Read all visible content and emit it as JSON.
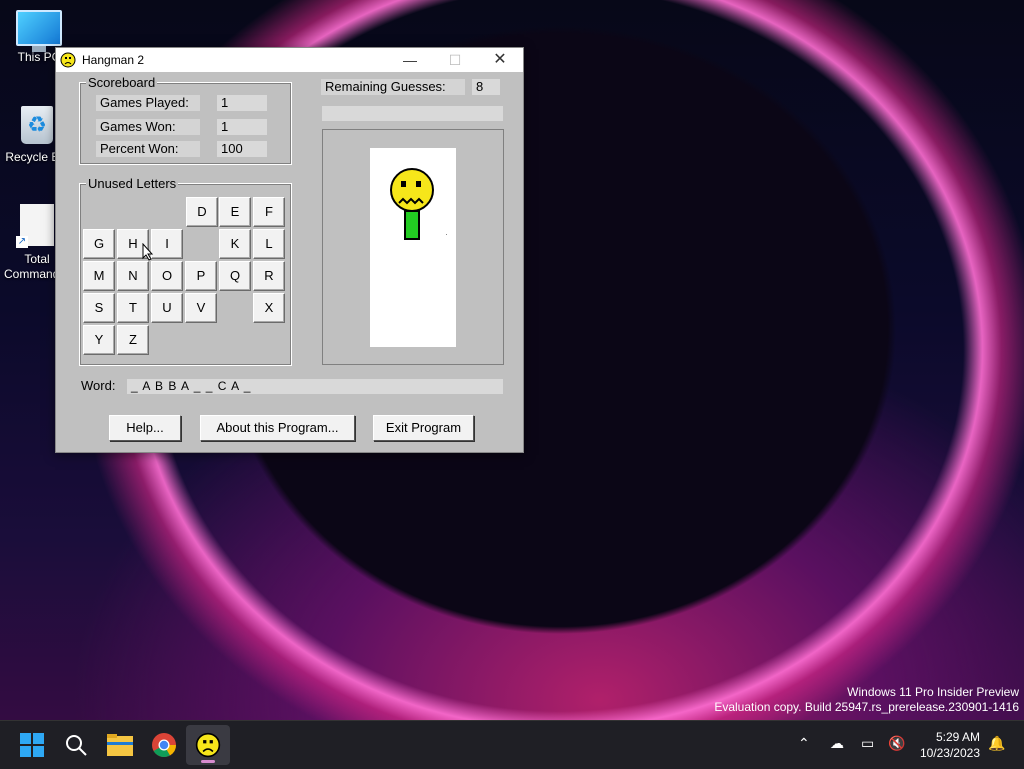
{
  "desktop": {
    "icons": [
      {
        "label": "This PC"
      },
      {
        "label": "Recycle Bin"
      },
      {
        "label": "Total Commander"
      }
    ]
  },
  "window": {
    "title": "Hangman 2",
    "scoreboard": {
      "title": "Scoreboard",
      "games_played_label": "Games Played:",
      "games_played": "1",
      "games_won_label": "Games Won:",
      "games_won": "1",
      "percent_won_label": "Percent Won:",
      "percent_won": "100"
    },
    "remaining": {
      "label": "Remaining Guesses:",
      "value": "8"
    },
    "unused_letters": {
      "title": "Unused Letters",
      "keys": [
        "D",
        "E",
        "F",
        "G",
        "H",
        "I",
        "K",
        "L",
        "M",
        "N",
        "O",
        "P",
        "Q",
        "R",
        "S",
        "T",
        "U",
        "V",
        "X",
        "Y",
        "Z"
      ]
    },
    "word": {
      "label": "Word:",
      "value": "_ A B B A _ _ C A _"
    },
    "buttons": {
      "help": "Help...",
      "about": "About this Program...",
      "exit": "Exit Program"
    }
  },
  "watermark": {
    "line1": "Windows 11 Pro Insider Preview",
    "line2": "Evaluation copy. Build 25947.rs_prerelease.230901-1416"
  },
  "taskbar": {
    "time": "5:29 AM",
    "date": "10/23/2023"
  },
  "colors": {
    "face": "#f6e61a",
    "stick": "#22cc22",
    "window_bg": "#c0c0c0"
  }
}
